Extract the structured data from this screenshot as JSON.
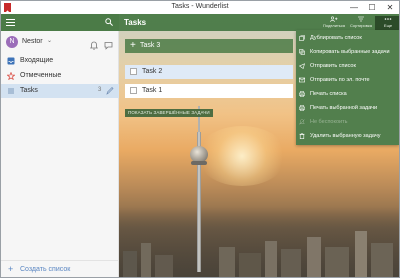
{
  "window": {
    "title": "Tasks - Wunderlist",
    "minimize": "—",
    "maximize": "☐",
    "close": "✕"
  },
  "sidebar": {
    "user": {
      "initial": "N",
      "name": "Nestor",
      "chevron": "⌄"
    },
    "items": [
      {
        "label": "Входящие",
        "icon": "inbox-icon",
        "count": ""
      },
      {
        "label": "Отмеченные",
        "icon": "star-icon",
        "count": ""
      },
      {
        "label": "Tasks",
        "icon": "list-icon",
        "count": "3"
      }
    ],
    "create_list": {
      "plus": "+",
      "label": "Создать список"
    }
  },
  "main": {
    "title": "Tasks",
    "header_buttons": [
      {
        "label": "Поделиться",
        "icon": "share-icon"
      },
      {
        "label": "Сортировка",
        "icon": "sort-icon"
      },
      {
        "label": "Еще",
        "icon": "more-icon"
      }
    ],
    "add_task": {
      "plus": "+",
      "label": "Task 3"
    },
    "tasks": [
      {
        "label": "Task 2",
        "selected": true
      },
      {
        "label": "Task 1",
        "selected": false
      }
    ],
    "show_completed": "ПОКАЗАТЬ ЗАВЕРШЁННЫЕ ЗАДАЧИ"
  },
  "menu": {
    "items": [
      {
        "label": "Дублировать список",
        "icon": "duplicate-icon",
        "disabled": false
      },
      {
        "label": "Копировать выбранные задачи",
        "icon": "copy-icon",
        "disabled": false
      },
      {
        "label": "Отправить список",
        "icon": "send-icon",
        "disabled": false
      },
      {
        "label": "Отправить по эл. почте",
        "icon": "email-icon",
        "disabled": false
      },
      {
        "label": "Печать списка",
        "icon": "print-icon",
        "disabled": false
      },
      {
        "label": "Печать выбранной задачи",
        "icon": "print-selected-icon",
        "disabled": false
      },
      {
        "label": "Не беспокоить",
        "icon": "do-not-disturb-icon",
        "disabled": true
      },
      {
        "label": "Удалить выбранную задачу",
        "icon": "trash-icon",
        "disabled": false
      }
    ]
  },
  "colors": {
    "accent": "#4b7b47",
    "menu": "#527f4d",
    "selected": "#d3e2f1",
    "link": "#5a86c2"
  }
}
